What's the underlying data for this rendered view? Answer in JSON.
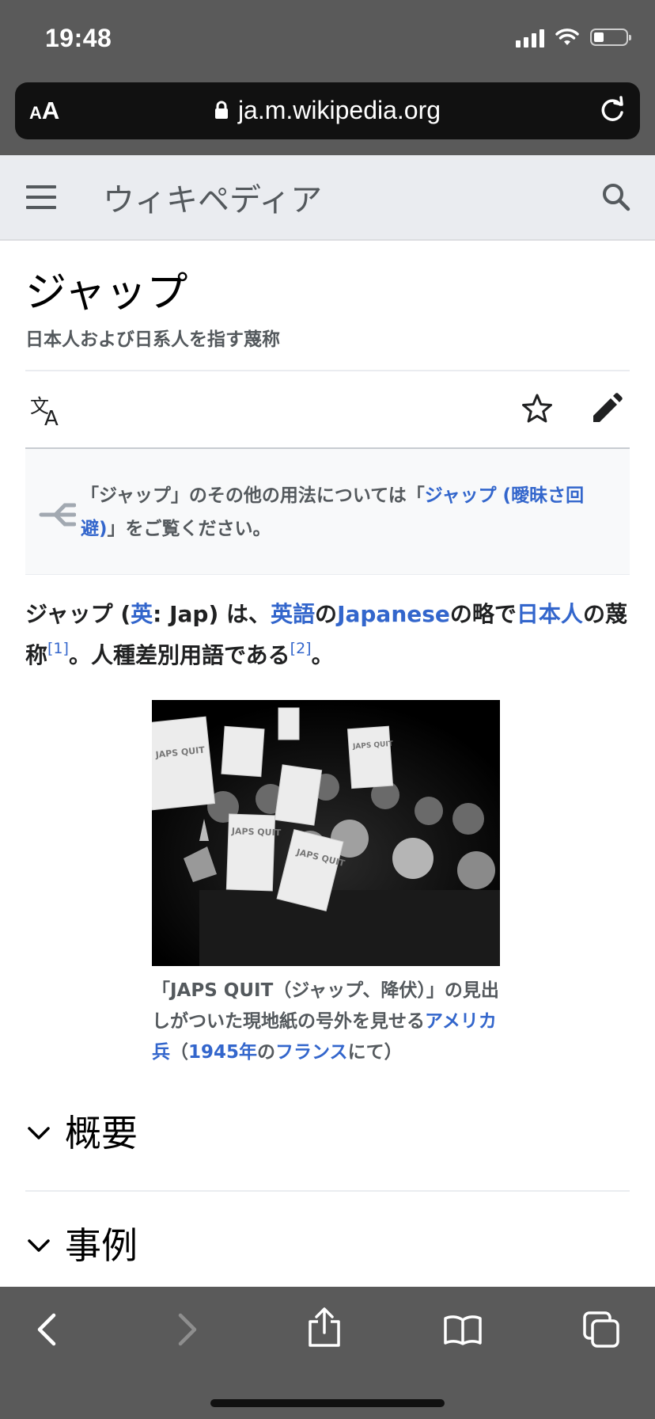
{
  "status_bar": {
    "time": "19:48"
  },
  "url_bar": {
    "text_size_label_small": "A",
    "text_size_label_large": "A",
    "url": "ja.m.wikipedia.org"
  },
  "wiki_header": {
    "wordmark": "ウィキペディア"
  },
  "article": {
    "title": "ジャップ",
    "subtitle": "日本人および日系人を指す蔑称",
    "hatnote": {
      "pre": "「ジャップ」のその他の用法については「",
      "link": "ジャップ (曖昧さ回避)",
      "post": "」をご覧ください。"
    },
    "lead": {
      "t1": "ジャップ (",
      "link_eng": "英",
      "t2": ": Jap) は、",
      "link_english": "英語",
      "t3": "の",
      "link_japanese": "Japanese",
      "t4": "の略で",
      "link_japanese_people": "日本人",
      "t5": "の蔑称",
      "ref1": "[1]",
      "t6": "。人種差別用語である",
      "ref2": "[2]",
      "t7": "。"
    },
    "figure": {
      "sign_text": "JAPS QUIT",
      "caption_t1": "「JAPS QUIT（ジャップ、降伏）」の見出しがついた現地紙の号外を見せる",
      "caption_link1": "アメリカ兵",
      "caption_t2": "（",
      "caption_link2": "1945年",
      "caption_t3": "の",
      "caption_link3": "フランス",
      "caption_t4": "にて）"
    },
    "sections": [
      "概要",
      "事例"
    ]
  },
  "colors": {
    "link": "#3366cc",
    "chrome": "#5a5a5a",
    "header_bg": "#eaecf0"
  }
}
